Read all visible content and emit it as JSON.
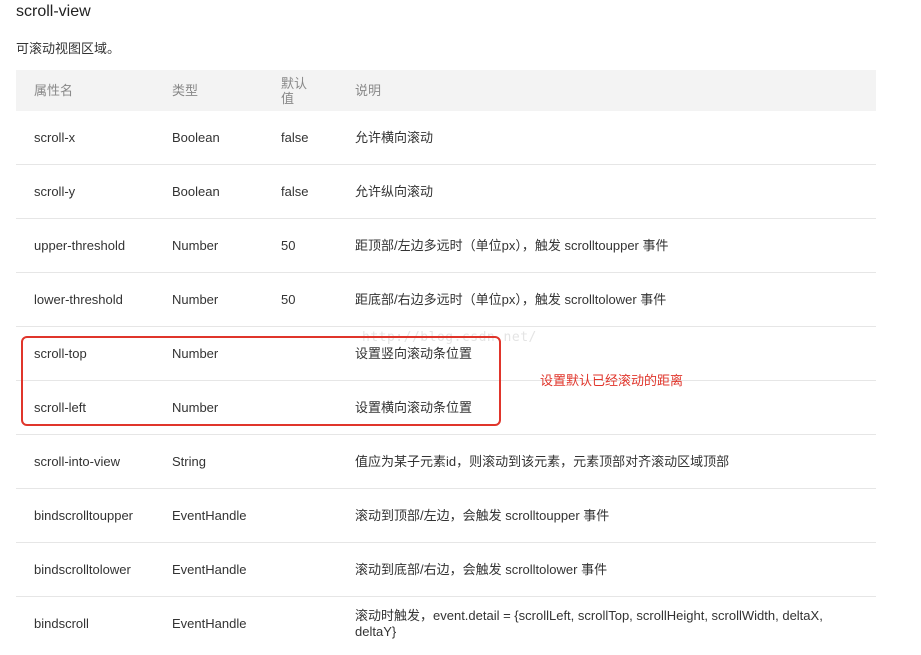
{
  "title": "scroll-view",
  "description": "可滚动视图区域。",
  "table": {
    "headers": [
      "属性名",
      "类型",
      "默认\n值",
      "说明"
    ],
    "rows": [
      {
        "name": "scroll-x",
        "type": "Boolean",
        "default": "false",
        "desc": "允许横向滚动"
      },
      {
        "name": "scroll-y",
        "type": "Boolean",
        "default": "false",
        "desc": "允许纵向滚动"
      },
      {
        "name": "upper-threshold",
        "type": "Number",
        "default": "50",
        "desc": "距顶部/左边多远时（单位px），触发 scrolltoupper 事件"
      },
      {
        "name": "lower-threshold",
        "type": "Number",
        "default": "50",
        "desc": "距底部/右边多远时（单位px），触发 scrolltolower 事件"
      },
      {
        "name": "scroll-top",
        "type": "Number",
        "default": "",
        "desc": "设置竖向滚动条位置"
      },
      {
        "name": "scroll-left",
        "type": "Number",
        "default": "",
        "desc": "设置横向滚动条位置"
      },
      {
        "name": "scroll-into-view",
        "type": "String",
        "default": "",
        "desc": "值应为某子元素id，则滚动到该元素，元素顶部对齐滚动区域顶部"
      },
      {
        "name": "bindscrolltoupper",
        "type": "EventHandle",
        "default": "",
        "desc": "滚动到顶部/左边，会触发 scrolltoupper 事件"
      },
      {
        "name": "bindscrolltolower",
        "type": "EventHandle",
        "default": "",
        "desc": "滚动到底部/右边，会触发 scrolltolower 事件"
      },
      {
        "name": "bindscroll",
        "type": "EventHandle",
        "default": "",
        "desc": "滚动时触发，event.detail = {scrollLeft, scrollTop, scrollHeight, scrollWidth, deltaX, deltaY}"
      }
    ]
  },
  "annotation": "设置默认已经滚动的距离",
  "watermark": "http://blog.csdn.net/",
  "colors": {
    "accent": "#e0352b",
    "header_bg": "#f3f3f3",
    "border": "#e6e6e6"
  }
}
